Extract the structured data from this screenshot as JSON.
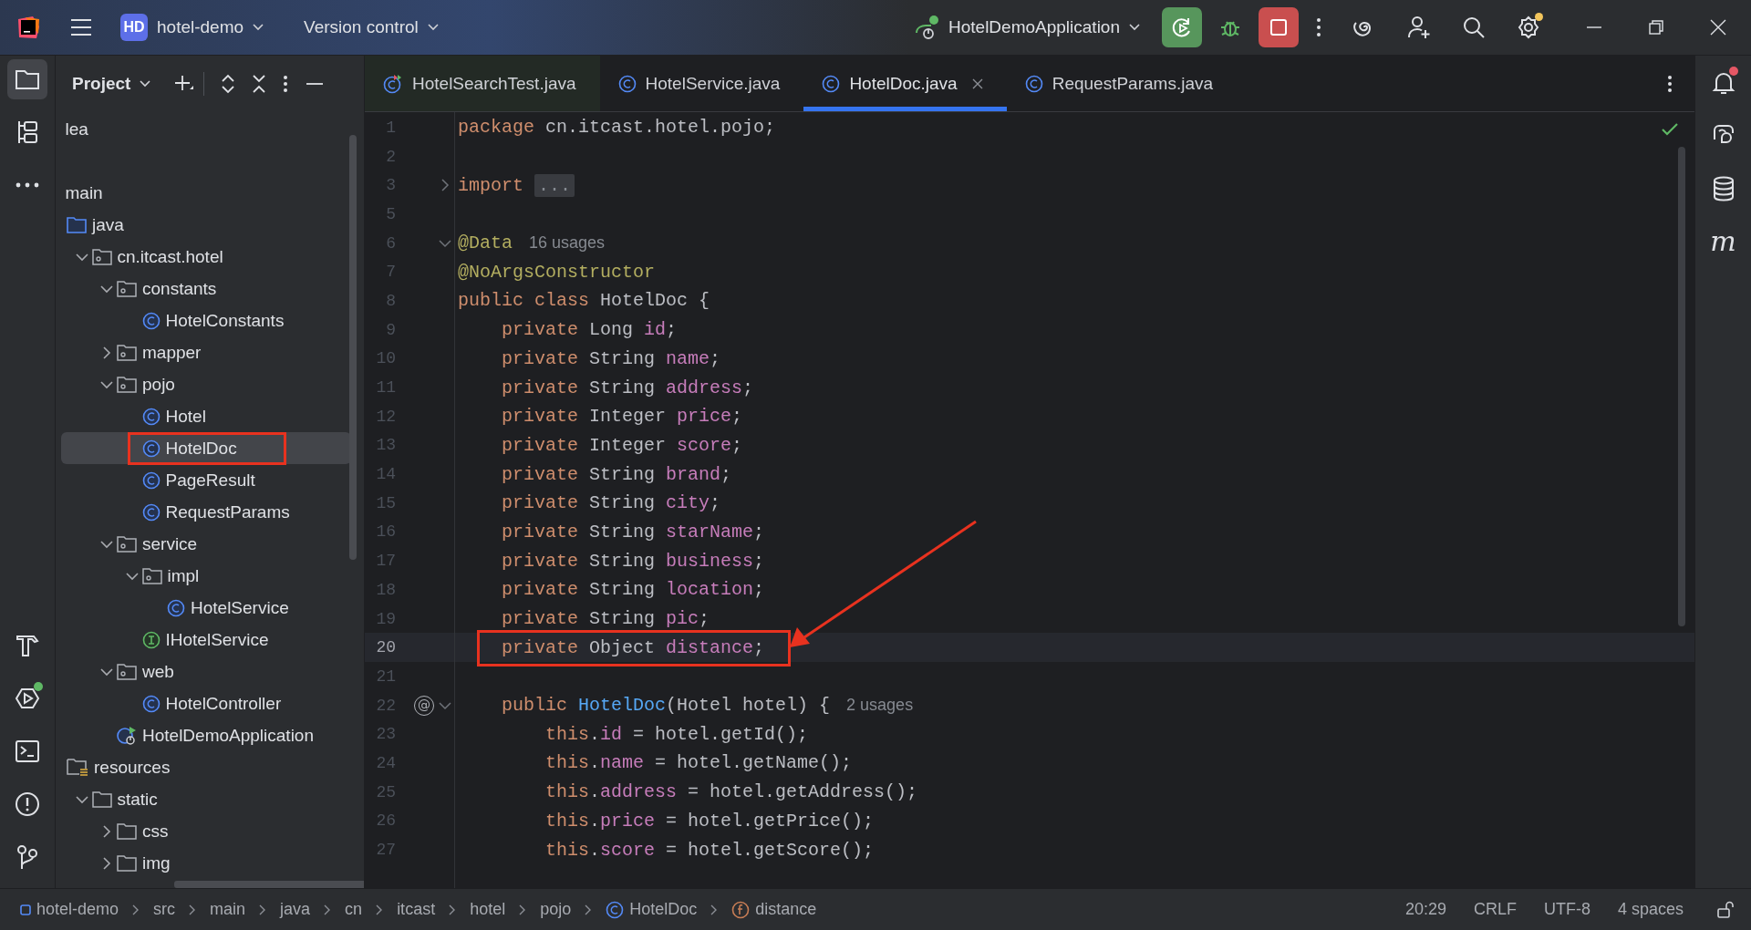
{
  "title_bar": {
    "project_badge": "HD",
    "project_name": "hotel-demo",
    "vcs_menu": "Version control",
    "run_config": "HotelDemoApplication",
    "settings_badge": true
  },
  "tool_strip_top": [
    {
      "kind": "project",
      "selected": true
    },
    {
      "kind": "structure",
      "selected": false
    },
    {
      "kind": "more",
      "selected": false
    }
  ],
  "tool_strip_bottom": [
    {
      "kind": "build"
    },
    {
      "kind": "services",
      "badge": true
    },
    {
      "kind": "terminal"
    },
    {
      "kind": "problems"
    },
    {
      "kind": "git"
    }
  ],
  "project": {
    "title": "Project",
    "tree": [
      {
        "label": "lea",
        "selected": false
      },
      {
        "label": "main",
        "selected": false,
        "children": [
          {
            "label": "java",
            "kind": "source-folder",
            "selected": false,
            "children": [
              {
                "label": "cn.itcast.hotel",
                "kind": "package",
                "expanded": true,
                "selected": false,
                "children": [
                  {
                    "label": "constants",
                    "kind": "package",
                    "expanded": true,
                    "selected": false,
                    "children": [
                      {
                        "label": "HotelConstants",
                        "kind": "class",
                        "selected": false
                      }
                    ]
                  },
                  {
                    "label": "mapper",
                    "kind": "package",
                    "expanded": false,
                    "selected": false
                  },
                  {
                    "label": "pojo",
                    "kind": "package",
                    "expanded": true,
                    "selected": false,
                    "children": [
                      {
                        "label": "Hotel",
                        "kind": "class",
                        "selected": false
                      },
                      {
                        "label": "HotelDoc",
                        "kind": "class",
                        "selected": true,
                        "boxed": true
                      },
                      {
                        "label": "PageResult",
                        "kind": "class",
                        "selected": false
                      },
                      {
                        "label": "RequestParams",
                        "kind": "class",
                        "selected": false
                      }
                    ]
                  },
                  {
                    "label": "service",
                    "kind": "package",
                    "expanded": true,
                    "selected": false,
                    "children": [
                      {
                        "label": "impl",
                        "kind": "package",
                        "expanded": true,
                        "selected": false,
                        "children": [
                          {
                            "label": "HotelService",
                            "kind": "class",
                            "selected": false
                          }
                        ]
                      },
                      {
                        "label": "IHotelService",
                        "kind": "interface",
                        "selected": false
                      }
                    ]
                  },
                  {
                    "label": "web",
                    "kind": "package",
                    "expanded": true,
                    "selected": false,
                    "children": [
                      {
                        "label": "HotelController",
                        "kind": "class",
                        "selected": false
                      }
                    ]
                  },
                  {
                    "label": "HotelDemoApplication",
                    "kind": "app-class",
                    "selected": false
                  }
                ]
              }
            ]
          },
          {
            "label": "resources",
            "kind": "resources-folder",
            "selected": false,
            "children": [
              {
                "label": "static",
                "kind": "folder",
                "expanded": true,
                "selected": false,
                "children": [
                  {
                    "label": "css",
                    "kind": "folder",
                    "expanded": false,
                    "selected": false
                  },
                  {
                    "label": "img",
                    "kind": "folder",
                    "expanded": false,
                    "selected": false
                  }
                ]
              }
            ]
          }
        ]
      }
    ]
  },
  "tabs": [
    {
      "label": "HotelSearchTest.java",
      "kind": "test-class",
      "selected": false
    },
    {
      "label": "HotelService.java",
      "kind": "class",
      "selected": false
    },
    {
      "label": "HotelDoc.java",
      "kind": "class",
      "selected": true
    },
    {
      "label": "RequestParams.java",
      "kind": "class",
      "selected": false
    }
  ],
  "editor": {
    "inspection_ok": true,
    "lines": [
      {
        "number": "1",
        "current": false,
        "tokens": [
          {
            "kind": "keyword",
            "text": "package "
          },
          {
            "kind": "plain",
            "text": "cn.itcast.hotel.pojo;"
          }
        ]
      },
      {
        "number": "2",
        "current": false
      },
      {
        "number": "3",
        "current": false,
        "expanded": false,
        "tokens": [
          {
            "kind": "keyword",
            "text": "import "
          },
          {
            "kind": "folded",
            "text": "..."
          }
        ]
      },
      {
        "number": "5",
        "current": false
      },
      {
        "number": "6",
        "current": false,
        "expanded": true,
        "tokens": [
          {
            "kind": "annotation",
            "text": "@Data"
          },
          {
            "kind": "hint",
            "text": "16 usages"
          }
        ]
      },
      {
        "number": "7",
        "current": false,
        "tokens": [
          {
            "kind": "annotation",
            "text": "@NoArgsConstructor"
          }
        ]
      },
      {
        "number": "8",
        "current": false,
        "tokens": [
          {
            "kind": "keyword",
            "text": "public class "
          },
          {
            "kind": "plain",
            "text": "HotelDoc {"
          }
        ]
      },
      {
        "number": "9",
        "current": false,
        "tokens": [
          {
            "kind": "keyword",
            "text": "    private "
          },
          {
            "kind": "plain",
            "text": "Long "
          },
          {
            "kind": "field",
            "text": "id"
          },
          {
            "kind": "plain",
            "text": ";"
          }
        ]
      },
      {
        "number": "10",
        "current": false,
        "tokens": [
          {
            "kind": "keyword",
            "text": "    private "
          },
          {
            "kind": "plain",
            "text": "String "
          },
          {
            "kind": "field",
            "text": "name"
          },
          {
            "kind": "plain",
            "text": ";"
          }
        ]
      },
      {
        "number": "11",
        "current": false,
        "tokens": [
          {
            "kind": "keyword",
            "text": "    private "
          },
          {
            "kind": "plain",
            "text": "String "
          },
          {
            "kind": "field",
            "text": "address"
          },
          {
            "kind": "plain",
            "text": ";"
          }
        ]
      },
      {
        "number": "12",
        "current": false,
        "tokens": [
          {
            "kind": "keyword",
            "text": "    private "
          },
          {
            "kind": "plain",
            "text": "Integer "
          },
          {
            "kind": "field",
            "text": "price"
          },
          {
            "kind": "plain",
            "text": ";"
          }
        ]
      },
      {
        "number": "13",
        "current": false,
        "tokens": [
          {
            "kind": "keyword",
            "text": "    private "
          },
          {
            "kind": "plain",
            "text": "Integer "
          },
          {
            "kind": "field",
            "text": "score"
          },
          {
            "kind": "plain",
            "text": ";"
          }
        ]
      },
      {
        "number": "14",
        "current": false,
        "tokens": [
          {
            "kind": "keyword",
            "text": "    private "
          },
          {
            "kind": "plain",
            "text": "String "
          },
          {
            "kind": "field",
            "text": "brand"
          },
          {
            "kind": "plain",
            "text": ";"
          }
        ]
      },
      {
        "number": "15",
        "current": false,
        "tokens": [
          {
            "kind": "keyword",
            "text": "    private "
          },
          {
            "kind": "plain",
            "text": "String "
          },
          {
            "kind": "field",
            "text": "city"
          },
          {
            "kind": "plain",
            "text": ";"
          }
        ]
      },
      {
        "number": "16",
        "current": false,
        "tokens": [
          {
            "kind": "keyword",
            "text": "    private "
          },
          {
            "kind": "plain",
            "text": "String "
          },
          {
            "kind": "field",
            "text": "starName"
          },
          {
            "kind": "plain",
            "text": ";"
          }
        ]
      },
      {
        "number": "17",
        "current": false,
        "tokens": [
          {
            "kind": "keyword",
            "text": "    private "
          },
          {
            "kind": "plain",
            "text": "String "
          },
          {
            "kind": "field",
            "text": "business"
          },
          {
            "kind": "plain",
            "text": ";"
          }
        ]
      },
      {
        "number": "18",
        "current": false,
        "tokens": [
          {
            "kind": "keyword",
            "text": "    private "
          },
          {
            "kind": "plain",
            "text": "String "
          },
          {
            "kind": "field",
            "text": "location"
          },
          {
            "kind": "plain",
            "text": ";"
          }
        ]
      },
      {
        "number": "19",
        "current": false,
        "tokens": [
          {
            "kind": "keyword",
            "text": "    private "
          },
          {
            "kind": "plain",
            "text": "String "
          },
          {
            "kind": "field",
            "text": "pic"
          },
          {
            "kind": "plain",
            "text": ";"
          }
        ]
      },
      {
        "number": "20",
        "current": true,
        "boxed": true,
        "tokens": [
          {
            "kind": "keyword",
            "text": "    private "
          },
          {
            "kind": "plain",
            "text": "Object "
          },
          {
            "kind": "field",
            "text": "distance"
          },
          {
            "kind": "plain",
            "text": ";"
          }
        ]
      },
      {
        "number": "21",
        "current": false
      },
      {
        "number": "22",
        "current": false,
        "expanded": true,
        "gutter_mark": "@",
        "tokens": [
          {
            "kind": "keyword",
            "text": "    public "
          },
          {
            "kind": "declaration",
            "text": "HotelDoc"
          },
          {
            "kind": "plain",
            "text": "(Hotel hotel) {"
          },
          {
            "kind": "hint",
            "text": "2 usages"
          }
        ]
      },
      {
        "number": "23",
        "current": false,
        "tokens": [
          {
            "kind": "keyword",
            "text": "        this"
          },
          {
            "kind": "plain",
            "text": "."
          },
          {
            "kind": "field",
            "text": "id"
          },
          {
            "kind": "plain",
            "text": " = hotel.getId();"
          }
        ]
      },
      {
        "number": "24",
        "current": false,
        "tokens": [
          {
            "kind": "keyword",
            "text": "        this"
          },
          {
            "kind": "plain",
            "text": "."
          },
          {
            "kind": "field",
            "text": "name"
          },
          {
            "kind": "plain",
            "text": " = hotel.getName();"
          }
        ]
      },
      {
        "number": "25",
        "current": false,
        "tokens": [
          {
            "kind": "keyword",
            "text": "        this"
          },
          {
            "kind": "plain",
            "text": "."
          },
          {
            "kind": "field",
            "text": "address"
          },
          {
            "kind": "plain",
            "text": " = hotel.getAddress();"
          }
        ]
      },
      {
        "number": "26",
        "current": false,
        "tokens": [
          {
            "kind": "keyword",
            "text": "        this"
          },
          {
            "kind": "plain",
            "text": "."
          },
          {
            "kind": "field",
            "text": "price"
          },
          {
            "kind": "plain",
            "text": " = hotel.getPrice();"
          }
        ]
      },
      {
        "number": "27",
        "current": false,
        "tokens": [
          {
            "kind": "keyword",
            "text": "        this"
          },
          {
            "kind": "plain",
            "text": "."
          },
          {
            "kind": "field",
            "text": "score"
          },
          {
            "kind": "plain",
            "text": " = hotel.getScore();"
          }
        ]
      }
    ]
  },
  "right_strip": [
    {
      "kind": "notifications",
      "badge": true
    },
    {
      "kind": "ai-chat"
    },
    {
      "kind": "database"
    },
    {
      "kind": "maven",
      "glyph": "m"
    }
  ],
  "status_bar": {
    "breadcrumbs": [
      {
        "label": "hotel-demo",
        "kind": "module"
      },
      {
        "label": "src"
      },
      {
        "label": "main"
      },
      {
        "label": "java"
      },
      {
        "label": "cn"
      },
      {
        "label": "itcast"
      },
      {
        "label": "hotel"
      },
      {
        "label": "pojo"
      },
      {
        "label": "HotelDoc",
        "kind": "class"
      },
      {
        "label": "distance",
        "kind": "field"
      }
    ],
    "items": [
      "20:29",
      "CRLF",
      "UTF-8",
      "4 spaces"
    ]
  }
}
